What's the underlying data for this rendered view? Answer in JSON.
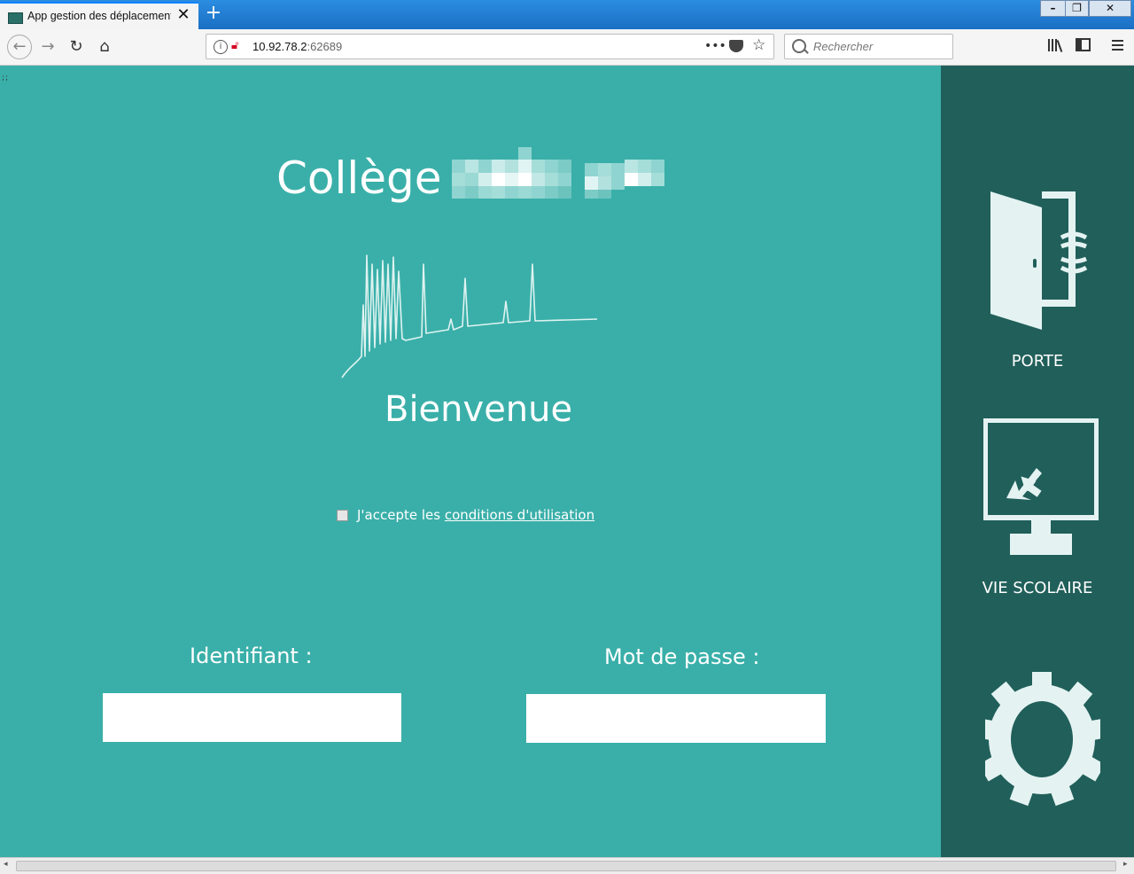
{
  "browser": {
    "tab_title": "App gestion des déplacements",
    "tab_close": "✕",
    "new_tab": "+",
    "url_host": "10.92.78.2",
    "url_port": ":62689",
    "url_more": "•••",
    "search_placeholder": "Rechercher"
  },
  "page": {
    "corner_mark": ";;",
    "title": "Collège",
    "welcome": "Bienvenue",
    "terms_prefix": "J'accepte les",
    "terms_link": "conditions d'utilisation",
    "terms_checked": false,
    "login_label": "Identifiant :",
    "password_label": "Mot de passe :",
    "login_value": "",
    "password_value": ""
  },
  "sidebar": {
    "items": [
      {
        "label": "PORTE",
        "icon": "door-icon"
      },
      {
        "label": "VIE SCOLAIRE",
        "icon": "monitor-icon"
      },
      {
        "label": "",
        "icon": "gear-icon"
      }
    ]
  },
  "colors": {
    "page_bg": "#3aafa9",
    "sidebar_bg": "#215f5a",
    "icon_fill": "#e4f3f2"
  }
}
